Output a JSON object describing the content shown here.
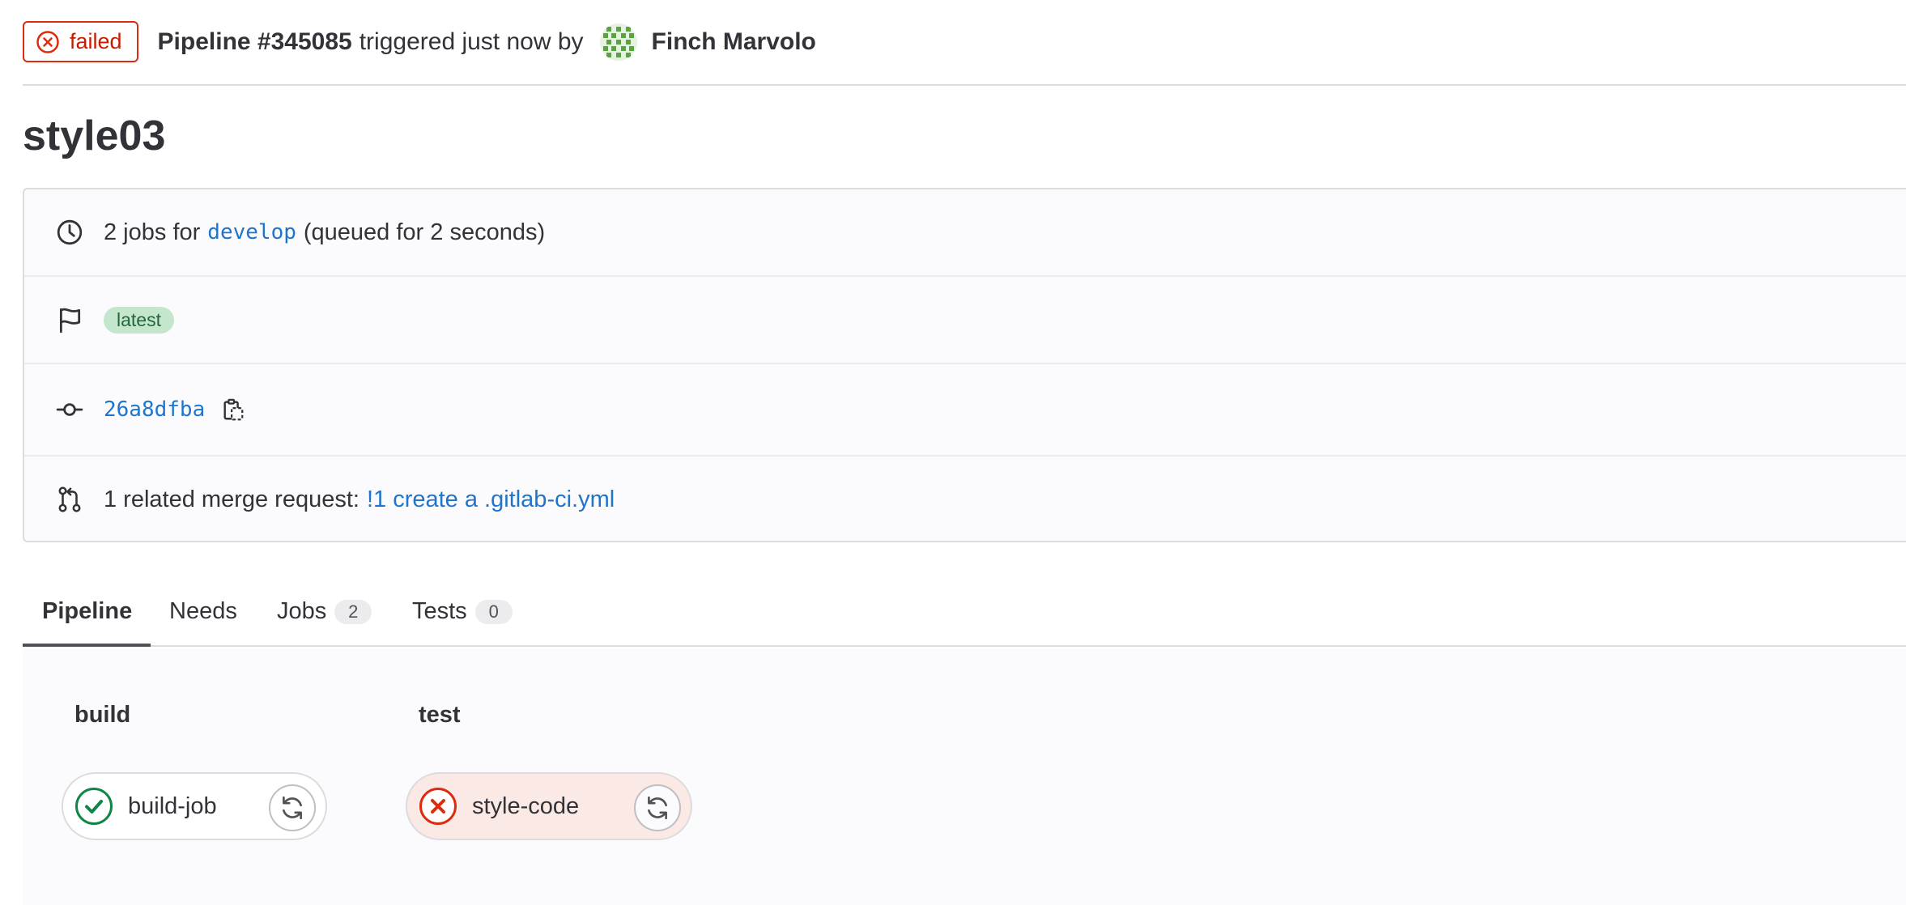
{
  "header": {
    "status_label": "failed",
    "pipeline_id": "Pipeline #345085",
    "triggered_text": "triggered just now by",
    "author": "Finch Marvolo"
  },
  "title": "style03",
  "info": {
    "jobs_prefix": "2 jobs for",
    "branch": "develop",
    "queued_text": "(queued for 2 seconds)",
    "tag": "latest",
    "commit_sha": "26a8dfba",
    "mr_prefix": "1 related merge request:",
    "mr_link": "!1 create a .gitlab-ci.yml"
  },
  "tabs": [
    {
      "label": "Pipeline",
      "active": true
    },
    {
      "label": "Needs"
    },
    {
      "label": "Jobs",
      "count": "2"
    },
    {
      "label": "Tests",
      "count": "0"
    }
  ],
  "stages": [
    {
      "name": "build",
      "job": {
        "name": "build-job",
        "status": "success"
      }
    },
    {
      "name": "test",
      "job": {
        "name": "style-code",
        "status": "failed"
      }
    }
  ],
  "colors": {
    "failed": "#dd2b0e",
    "success": "#108548",
    "link": "#1f75cb",
    "tag_bg": "#c3e6cd"
  },
  "icons": {
    "status": "status-failed-icon",
    "queue": "clock-icon",
    "tag": "flag-icon",
    "commit": "commit-icon",
    "copy": "copy-to-clipboard-icon",
    "merge_request": "merge-request-icon",
    "retry": "retry-icon"
  }
}
